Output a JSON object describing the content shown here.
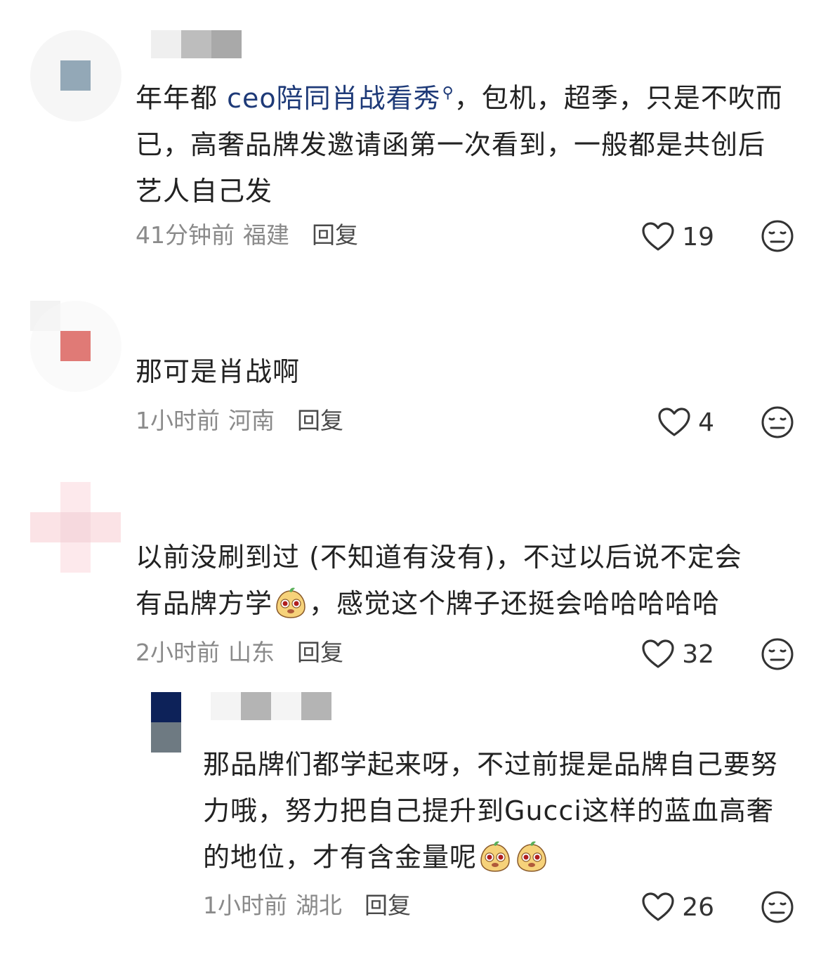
{
  "comments": [
    {
      "text_pre": "年年都 ",
      "link_text": "ceo陪同肖战看秀",
      "text_post": "，包机，超季，只是不吹而已，高奢品牌发邀请函第一次看到，一般都是共创后艺人自己发",
      "time": "41分钟前",
      "location": "福建",
      "reply_label": "回复",
      "likes": "19"
    },
    {
      "text": "那可是肖战啊",
      "time": "1小时前",
      "location": "河南",
      "reply_label": "回复",
      "likes": "4"
    },
    {
      "text_line1": "以前没刷到过 (不知道有没有)，不过以后说不定会",
      "text_line2_pre": "有品牌方学",
      "text_line2_post": "，感觉这个牌子还挺会哈哈哈哈哈",
      "time": "2小时前",
      "location": "山东",
      "reply_label": "回复",
      "likes": "32"
    }
  ],
  "reply": {
    "text": "那品牌们都学起来呀，不过前提是品牌自己要努力哦，努力把自己提升到Gucci这样的蓝血高奢的地位，才有含金量呢",
    "time": "1小时前",
    "location": "湖北",
    "reply_label": "回复",
    "likes": "26"
  },
  "icons": {
    "like": "heart-outline-icon",
    "dislike": "meh-face-icon",
    "emoji": "cartoon-face-emoji",
    "link": "search-icon"
  },
  "colors": {
    "link": "#1e3a78",
    "meta": "#8a8a8a"
  }
}
